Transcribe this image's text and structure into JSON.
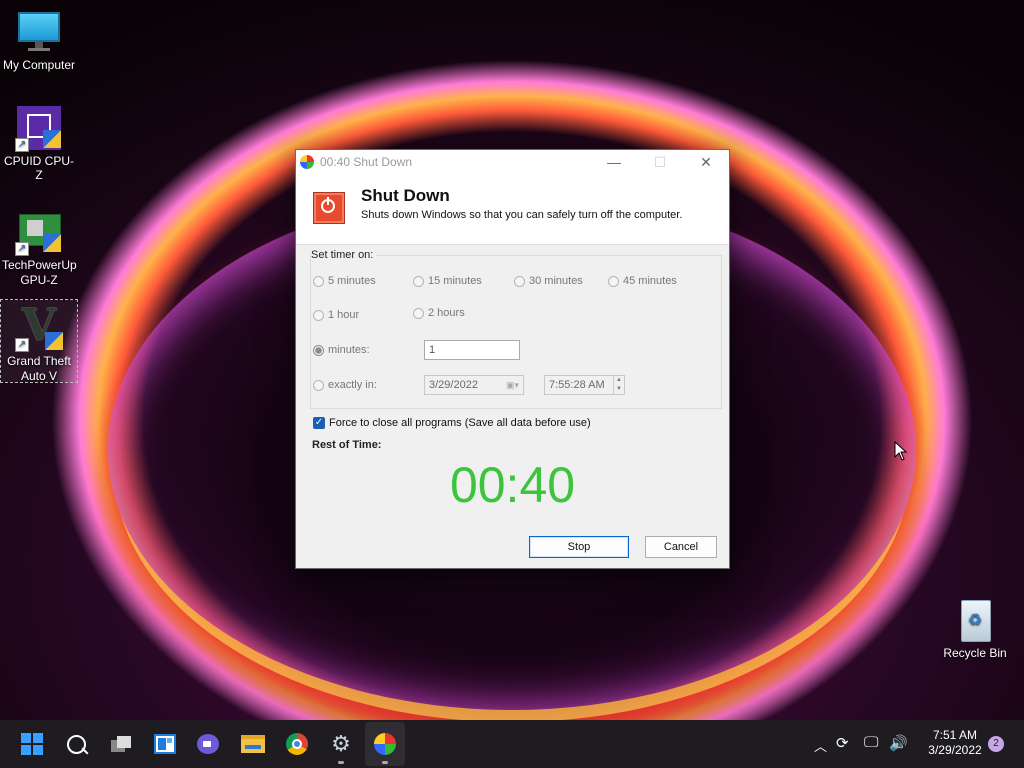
{
  "desktop": {
    "icons": [
      {
        "label": "My Computer",
        "icon": "monitor-icon"
      },
      {
        "label": "CPUID CPU-Z",
        "icon": "cpu-z-icon"
      },
      {
        "label": "TechPowerUp GPU-Z",
        "icon": "gpu-z-icon"
      },
      {
        "label": "Grand Theft Auto V",
        "icon": "gta-v-icon"
      },
      {
        "label": "Recycle Bin",
        "icon": "recycle-bin-icon"
      }
    ]
  },
  "dialog": {
    "window_title": "00:40 Shut Down",
    "header_title": "Shut Down",
    "header_desc": "Shuts down Windows so that you can safely turn off the computer.",
    "group_label": "Set timer on:",
    "radios": [
      "5 minutes",
      "15 minutes",
      "30 minutes",
      "45 minutes",
      "1 hour",
      "2 hours"
    ],
    "minutes_label": "minutes:",
    "minutes_value": "1",
    "exactly_label": "exactly in:",
    "date_value": "3/29/2022",
    "time_value": "7:55:28 AM",
    "force_label": "Force to close all programs (Save all data before use)",
    "force_checked": true,
    "rest_label": "Rest of Time:",
    "timer_value": "00:40",
    "timer_color": "#3dc43d",
    "stop_label": "Stop",
    "cancel_label": "Cancel"
  },
  "taskbar": {
    "time": "7:51 AM",
    "date": "3/29/2022",
    "notification_count": "2"
  }
}
